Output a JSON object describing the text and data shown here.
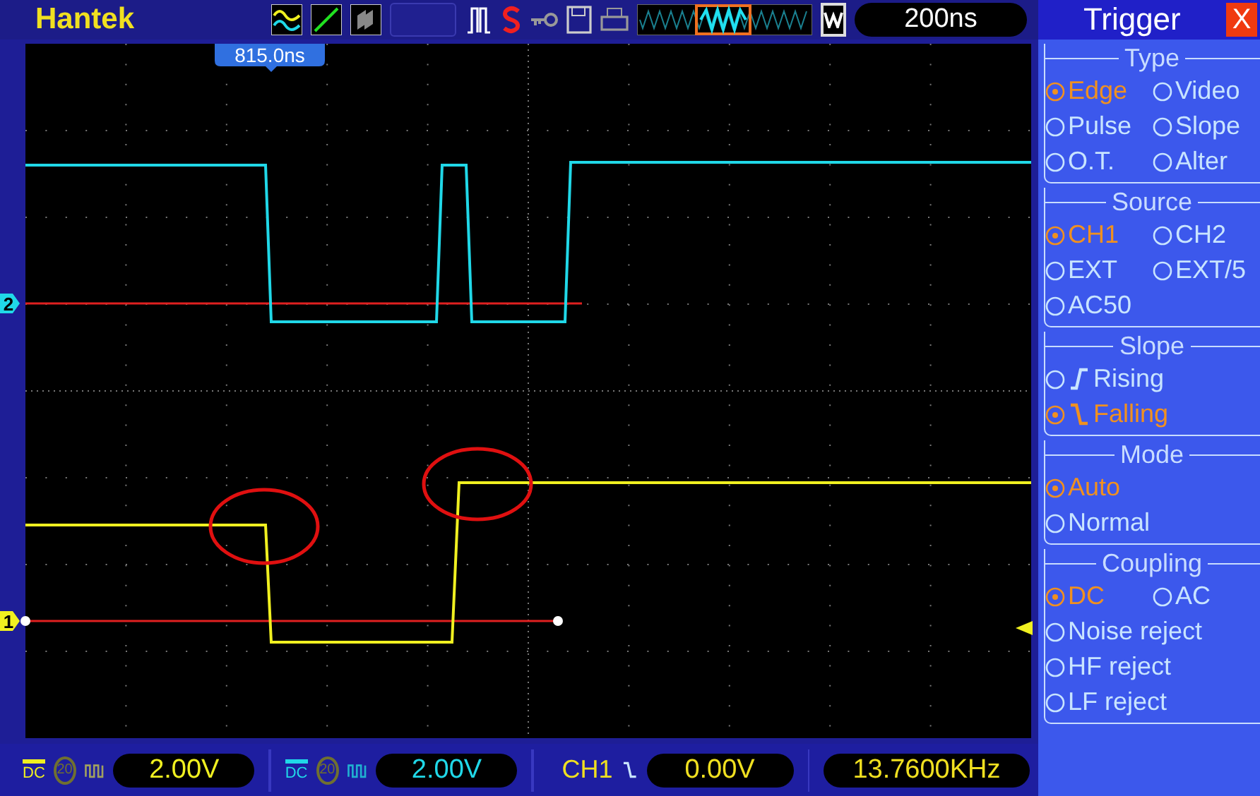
{
  "header": {
    "brand": "Hantek",
    "timebase": "200ns",
    "trigger_offset": "815.0ns"
  },
  "markers": [
    {
      "label": "2",
      "color": "#20d8e8"
    },
    {
      "label": "1",
      "color": "#f0f020"
    }
  ],
  "panel": {
    "title": "Trigger",
    "close": "X",
    "groups": [
      {
        "title": "Type",
        "rows": [
          [
            {
              "label": "Edge",
              "selected": true
            },
            {
              "label": "Video",
              "selected": false
            }
          ],
          [
            {
              "label": "Pulse",
              "selected": false
            },
            {
              "label": "Slope",
              "selected": false
            }
          ],
          [
            {
              "label": "O.T.",
              "selected": false
            },
            {
              "label": "Alter",
              "selected": false
            }
          ]
        ]
      },
      {
        "title": "Source",
        "rows": [
          [
            {
              "label": "CH1",
              "selected": true
            },
            {
              "label": "CH2",
              "selected": false
            }
          ],
          [
            {
              "label": "EXT",
              "selected": false
            },
            {
              "label": "EXT/5",
              "selected": false
            }
          ],
          [
            {
              "label": "AC50",
              "selected": false
            }
          ]
        ]
      },
      {
        "title": "Slope",
        "rows": [
          [
            {
              "label": "Rising",
              "selected": false,
              "kind": "rising"
            }
          ],
          [
            {
              "label": "Falling",
              "selected": true,
              "kind": "falling"
            }
          ]
        ]
      },
      {
        "title": "Mode",
        "rows": [
          [
            {
              "label": "Auto",
              "selected": true
            }
          ],
          [
            {
              "label": "Normal",
              "selected": false
            }
          ]
        ]
      },
      {
        "title": "Coupling",
        "rows": [
          [
            {
              "label": "DC",
              "selected": true
            },
            {
              "label": "AC",
              "selected": false
            }
          ],
          [
            {
              "label": "Noise reject",
              "selected": false
            }
          ],
          [
            {
              "label": "HF reject",
              "selected": false
            }
          ],
          [
            {
              "label": "LF reject",
              "selected": false
            }
          ]
        ]
      }
    ]
  },
  "status": {
    "channels": [
      {
        "coupling": "DC",
        "bandwidth": "20",
        "volts": "2.00V",
        "color": "#f0f020"
      },
      {
        "coupling": "DC",
        "bandwidth": "20",
        "volts": "2.00V",
        "color": "#20d8e8"
      }
    ],
    "trigger": {
      "source": "CH1",
      "level": "0.00V"
    },
    "frequency": "13.7600KHz"
  }
}
